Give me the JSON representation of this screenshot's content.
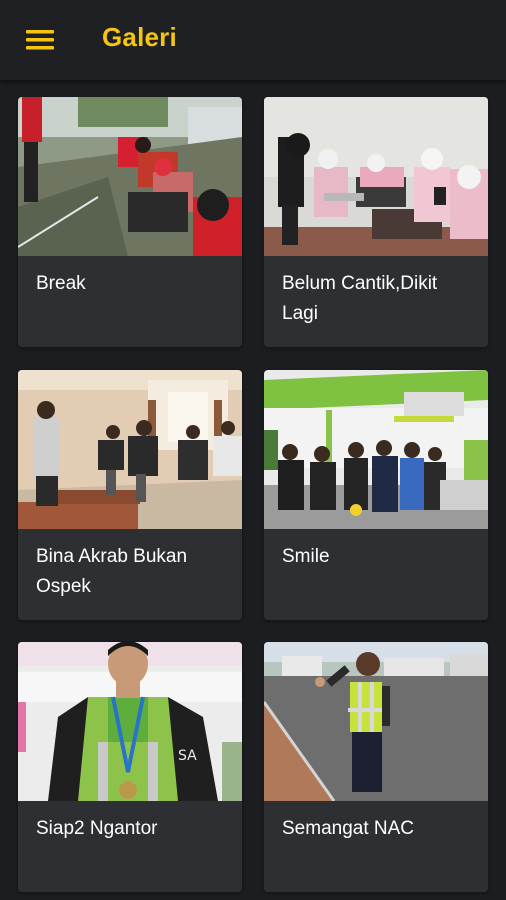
{
  "app_bar": {
    "title": "Galeri",
    "menu_icon": "hamburger-menu-icon",
    "title_color": "#f6c50f",
    "background": "#1e2024"
  },
  "gallery": {
    "items": [
      {
        "caption": "Break"
      },
      {
        "caption": "Belum Cantik,Dikit Lagi"
      },
      {
        "caption": "Bina Akrab Bukan Ospek"
      },
      {
        "caption": "Smile"
      },
      {
        "caption": "Siap2 Ngantor"
      },
      {
        "caption": "Semangat NAC"
      }
    ],
    "card_background": "#2d2f32"
  }
}
